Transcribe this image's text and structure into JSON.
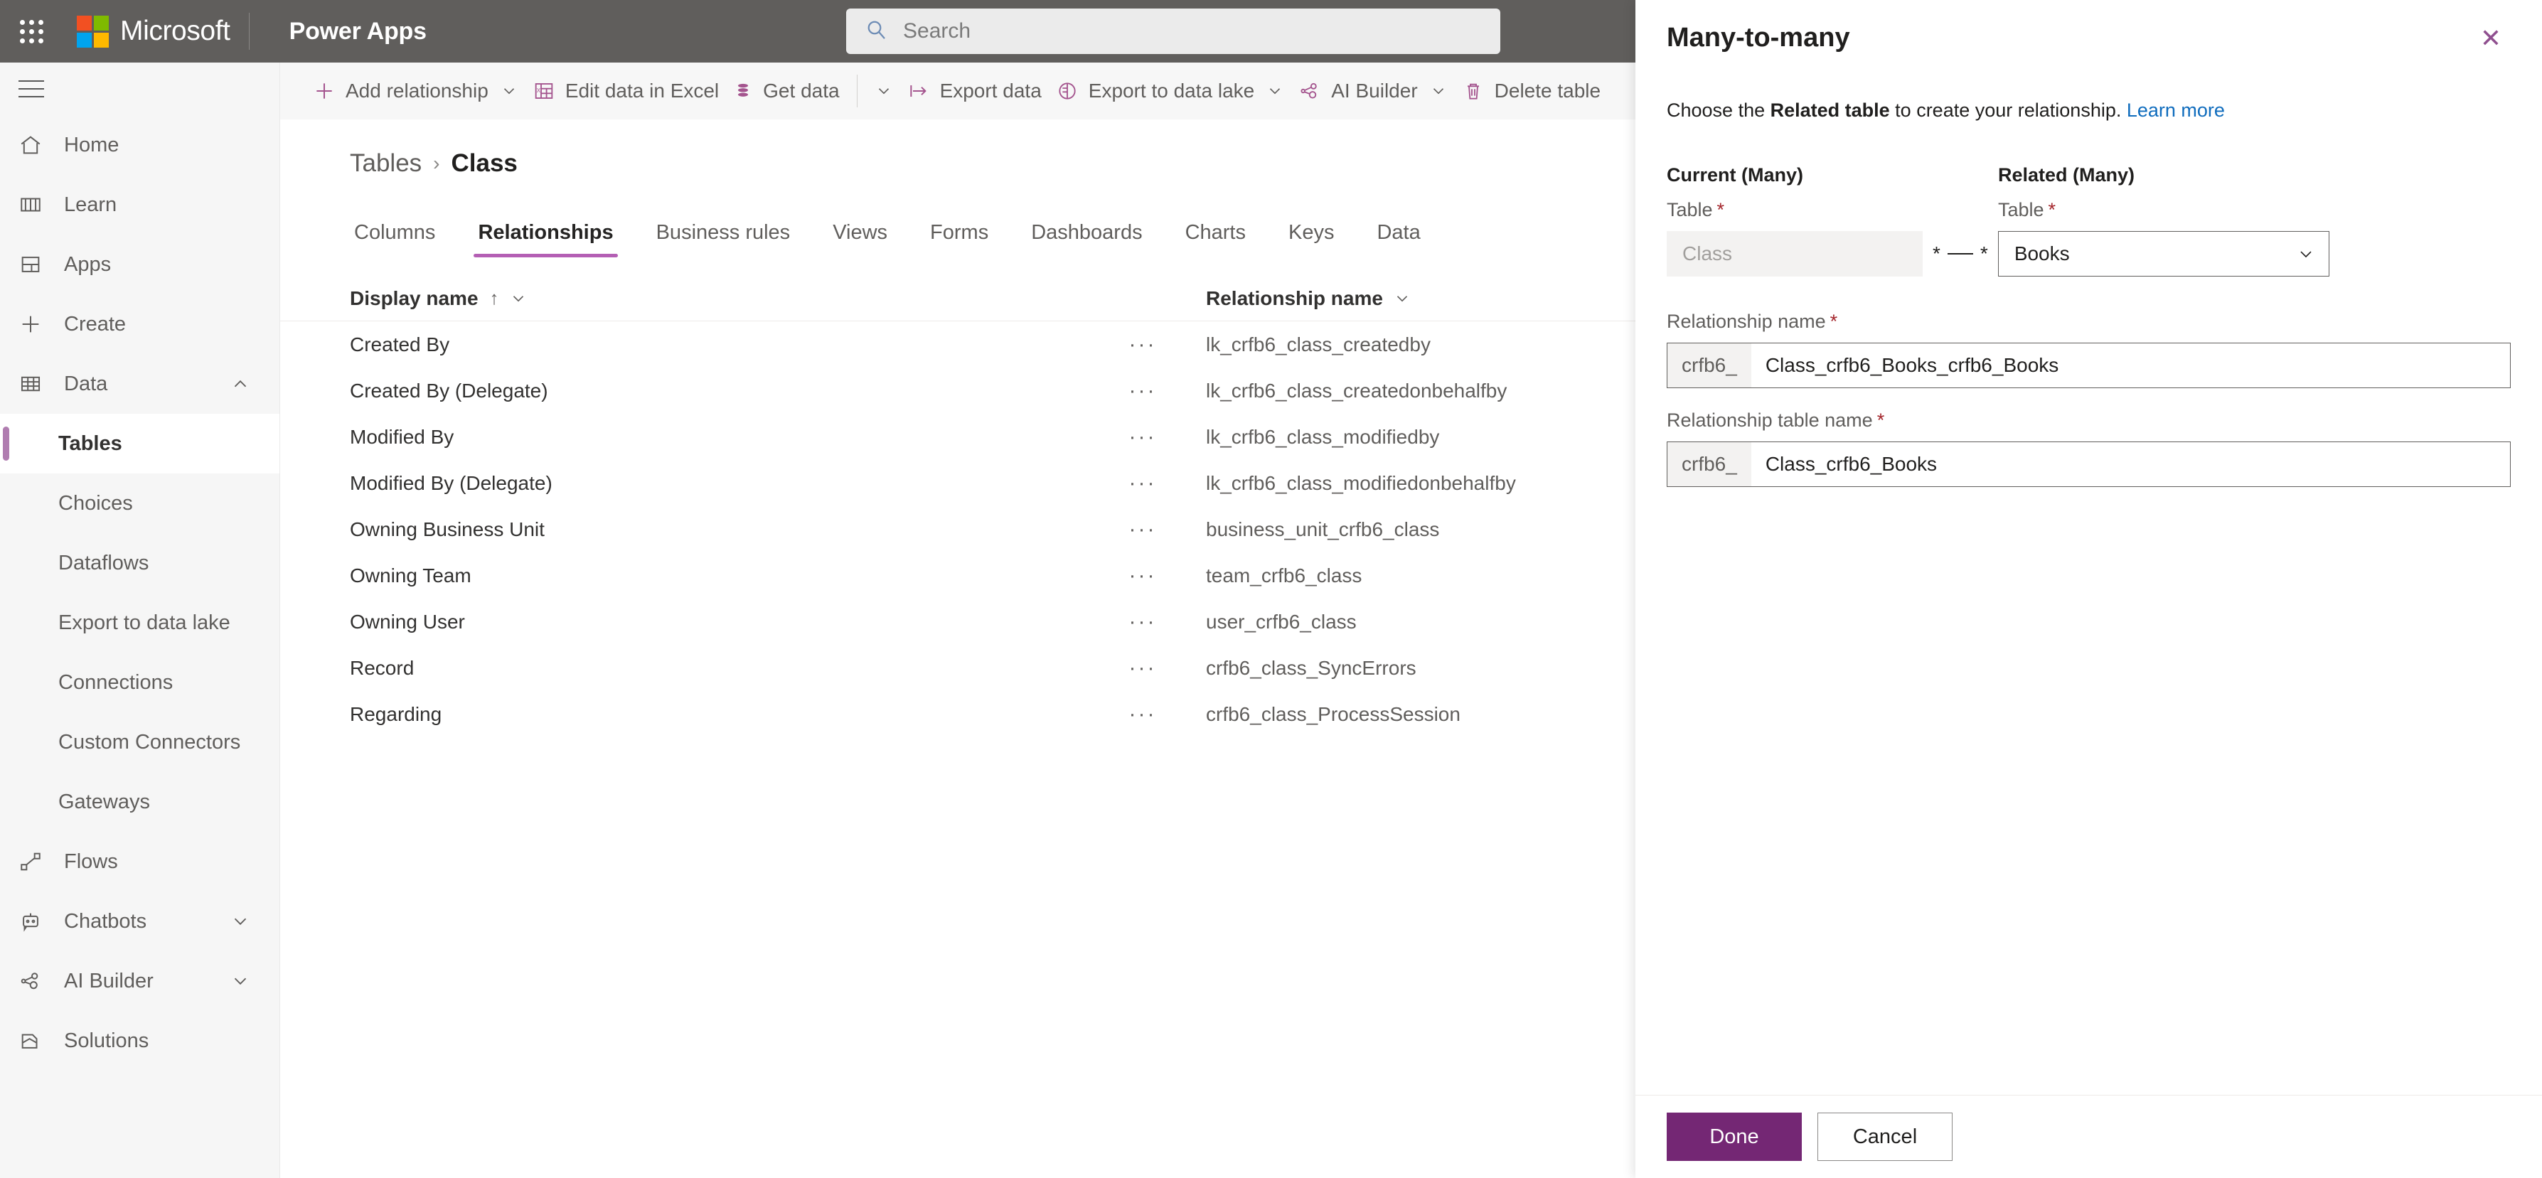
{
  "suite": {
    "waffle": "app-launcher",
    "brand": "Microsoft",
    "app_name": "Power Apps",
    "search_placeholder": "Search"
  },
  "sidebar": {
    "items": [
      {
        "label": "Home",
        "icon": "home-icon",
        "chevron": ""
      },
      {
        "label": "Learn",
        "icon": "book-icon",
        "chevron": ""
      },
      {
        "label": "Apps",
        "icon": "apps-grid-icon",
        "chevron": ""
      },
      {
        "label": "Create",
        "icon": "plus-icon",
        "chevron": ""
      },
      {
        "label": "Data",
        "icon": "table-icon",
        "chevron": "chevron-up-icon"
      }
    ],
    "data_children": [
      {
        "label": "Tables",
        "selected": true
      },
      {
        "label": "Choices",
        "selected": false
      },
      {
        "label": "Dataflows",
        "selected": false
      },
      {
        "label": "Export to data lake",
        "selected": false
      },
      {
        "label": "Connections",
        "selected": false
      },
      {
        "label": "Custom Connectors",
        "selected": false
      },
      {
        "label": "Gateways",
        "selected": false
      }
    ],
    "bottom_items": [
      {
        "label": "Flows",
        "icon": "flow-icon",
        "chevron": ""
      },
      {
        "label": "Chatbots",
        "icon": "bot-icon",
        "chevron": "chevron-down-icon"
      },
      {
        "label": "AI Builder",
        "icon": "ai-builder-icon",
        "chevron": "chevron-down-icon"
      },
      {
        "label": "Solutions",
        "icon": "solutions-icon",
        "chevron": ""
      }
    ]
  },
  "commandbar": {
    "commands": [
      {
        "label": "Add relationship",
        "icon": "plus-icon",
        "chevron": "chevron-down-icon",
        "sep_after": false
      },
      {
        "label": "Edit data in Excel",
        "icon": "excel-icon",
        "chevron": "",
        "sep_after": false
      },
      {
        "label": "Get data",
        "icon": "database-icon",
        "chevron": "",
        "sep_after": true
      },
      {
        "label": "",
        "icon": "",
        "chevron": "chevron-down-icon",
        "sep_after": false
      },
      {
        "label": "Export data",
        "icon": "export-icon",
        "chevron": "",
        "sep_after": false
      },
      {
        "label": "Export to data lake",
        "icon": "data-lake-icon",
        "chevron": "chevron-down-icon",
        "sep_after": false
      },
      {
        "label": "AI Builder",
        "icon": "ai-builder-icon",
        "chevron": "chevron-down-icon",
        "sep_after": false
      },
      {
        "label": "Delete table",
        "icon": "trash-icon",
        "chevron": "",
        "sep_after": false
      }
    ]
  },
  "breadcrumb": {
    "root": "Tables",
    "separator": "›",
    "current": "Class"
  },
  "tabs": [
    {
      "label": "Columns",
      "active": false
    },
    {
      "label": "Relationships",
      "active": true
    },
    {
      "label": "Business rules",
      "active": false
    },
    {
      "label": "Views",
      "active": false
    },
    {
      "label": "Forms",
      "active": false
    },
    {
      "label": "Dashboards",
      "active": false
    },
    {
      "label": "Charts",
      "active": false
    },
    {
      "label": "Keys",
      "active": false
    },
    {
      "label": "Data",
      "active": false
    }
  ],
  "grid": {
    "columns": {
      "display_name": "Display name",
      "sort_indicator": "↑",
      "relationship_name": "Relationship name"
    },
    "rows": [
      {
        "display_name": "Created By",
        "relationship_name": "lk_crfb6_class_createdby"
      },
      {
        "display_name": "Created By (Delegate)",
        "relationship_name": "lk_crfb6_class_createdonbehalfby"
      },
      {
        "display_name": "Modified By",
        "relationship_name": "lk_crfb6_class_modifiedby"
      },
      {
        "display_name": "Modified By (Delegate)",
        "relationship_name": "lk_crfb6_class_modifiedonbehalfby"
      },
      {
        "display_name": "Owning Business Unit",
        "relationship_name": "business_unit_crfb6_class"
      },
      {
        "display_name": "Owning Team",
        "relationship_name": "team_crfb6_class"
      },
      {
        "display_name": "Owning User",
        "relationship_name": "user_crfb6_class"
      },
      {
        "display_name": "Record",
        "relationship_name": "crfb6_class_SyncErrors"
      },
      {
        "display_name": "Regarding",
        "relationship_name": "crfb6_class_ProcessSession"
      }
    ],
    "row_menu_glyph": "···"
  },
  "panel": {
    "title": "Many-to-many",
    "close_glyph": "✕",
    "description_prefix": "Choose the ",
    "description_bold": "Related table",
    "description_suffix": " to create your relationship. ",
    "learn_more": "Learn more",
    "current_group_title": "Current (Many)",
    "related_group_title": "Related (Many)",
    "current_table_label": "Table",
    "related_table_label": "Table",
    "current_table_value": "Class",
    "related_table_value": "Books",
    "multiplicity_left": "*",
    "multiplicity_right": "*",
    "relationship_name_label": "Relationship name",
    "relationship_name_prefix": "crfb6_",
    "relationship_name_value": "Class_crfb6_Books_crfb6_Books",
    "relationship_table_name_label": "Relationship table name",
    "relationship_table_name_prefix": "crfb6_",
    "relationship_table_name_value": "Class_crfb6_Books",
    "required_marker": "*",
    "done_label": "Done",
    "cancel_label": "Cancel"
  },
  "colors": {
    "brand_purple": "#742774",
    "accent_purple": "#b45fb4",
    "icon_purple": "#a4548e",
    "suite_bar": "#605e5c",
    "link_blue": "#0f6cbd",
    "required_red": "#a4262c"
  }
}
